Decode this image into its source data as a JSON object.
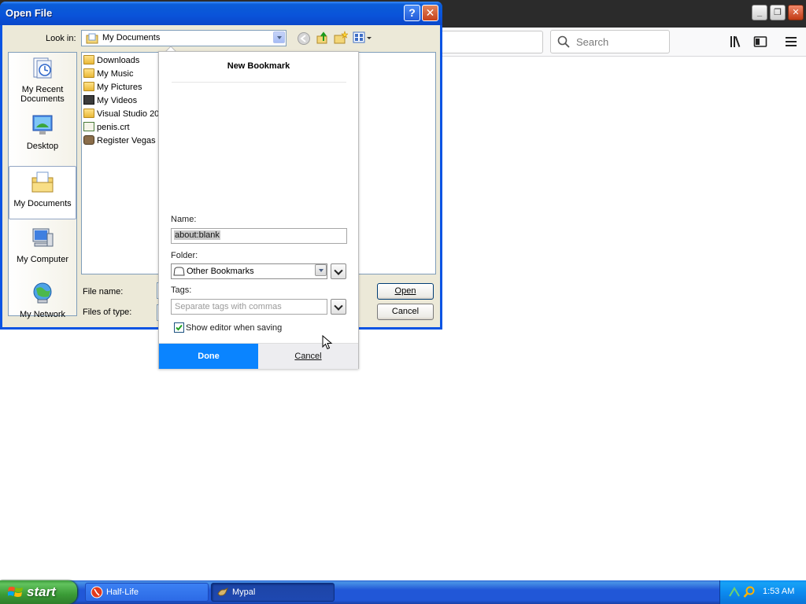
{
  "firefox": {
    "search_placeholder": "Search"
  },
  "open_file": {
    "title": "Open File",
    "help_glyph": "?",
    "close_glyph": "✕",
    "look_in_label": "Look in:",
    "look_in_value": "My Documents",
    "places": [
      {
        "label": "My Recent Documents",
        "icon": "recent-documents-icon"
      },
      {
        "label": "Desktop",
        "icon": "desktop-icon"
      },
      {
        "label": "My Documents",
        "icon": "my-documents-icon",
        "selected": true
      },
      {
        "label": "My Computer",
        "icon": "my-computer-icon"
      },
      {
        "label": "My Network",
        "icon": "my-network-icon"
      }
    ],
    "files": [
      {
        "name": "Downloads",
        "icon": "folder-icon"
      },
      {
        "name": "My Music",
        "icon": "music-folder-icon"
      },
      {
        "name": "My Pictures",
        "icon": "pictures-folder-icon"
      },
      {
        "name": "My Videos",
        "icon": "videos-folder-icon"
      },
      {
        "name": "Visual Studio 200",
        "icon": "folder-icon"
      },
      {
        "name": "penis.crt",
        "icon": "certificate-icon"
      },
      {
        "name": "Register Vegas F",
        "icon": "app-icon"
      }
    ],
    "file_name_label": "File name:",
    "files_of_type_label": "Files of type:",
    "open_button": "Open",
    "cancel_button": "Cancel"
  },
  "bookmark": {
    "title": "New Bookmark",
    "name_label": "Name:",
    "name_value": "about:blank",
    "folder_label": "Folder:",
    "folder_value": "Other Bookmarks",
    "tags_label": "Tags:",
    "tags_placeholder": "Separate tags with commas",
    "show_editor_label": "Show editor when saving",
    "show_editor_checked": true,
    "done_button": "Done",
    "cancel_button": "Cancel",
    "accent_color": "#0a84ff"
  },
  "taskbar": {
    "start_label": "start",
    "tasks": [
      {
        "label": "Half-Life",
        "icon": "half-life-icon",
        "active": false
      },
      {
        "label": "Mypal",
        "icon": "mypal-icon",
        "active": true
      }
    ],
    "clock": "1:53 AM"
  }
}
